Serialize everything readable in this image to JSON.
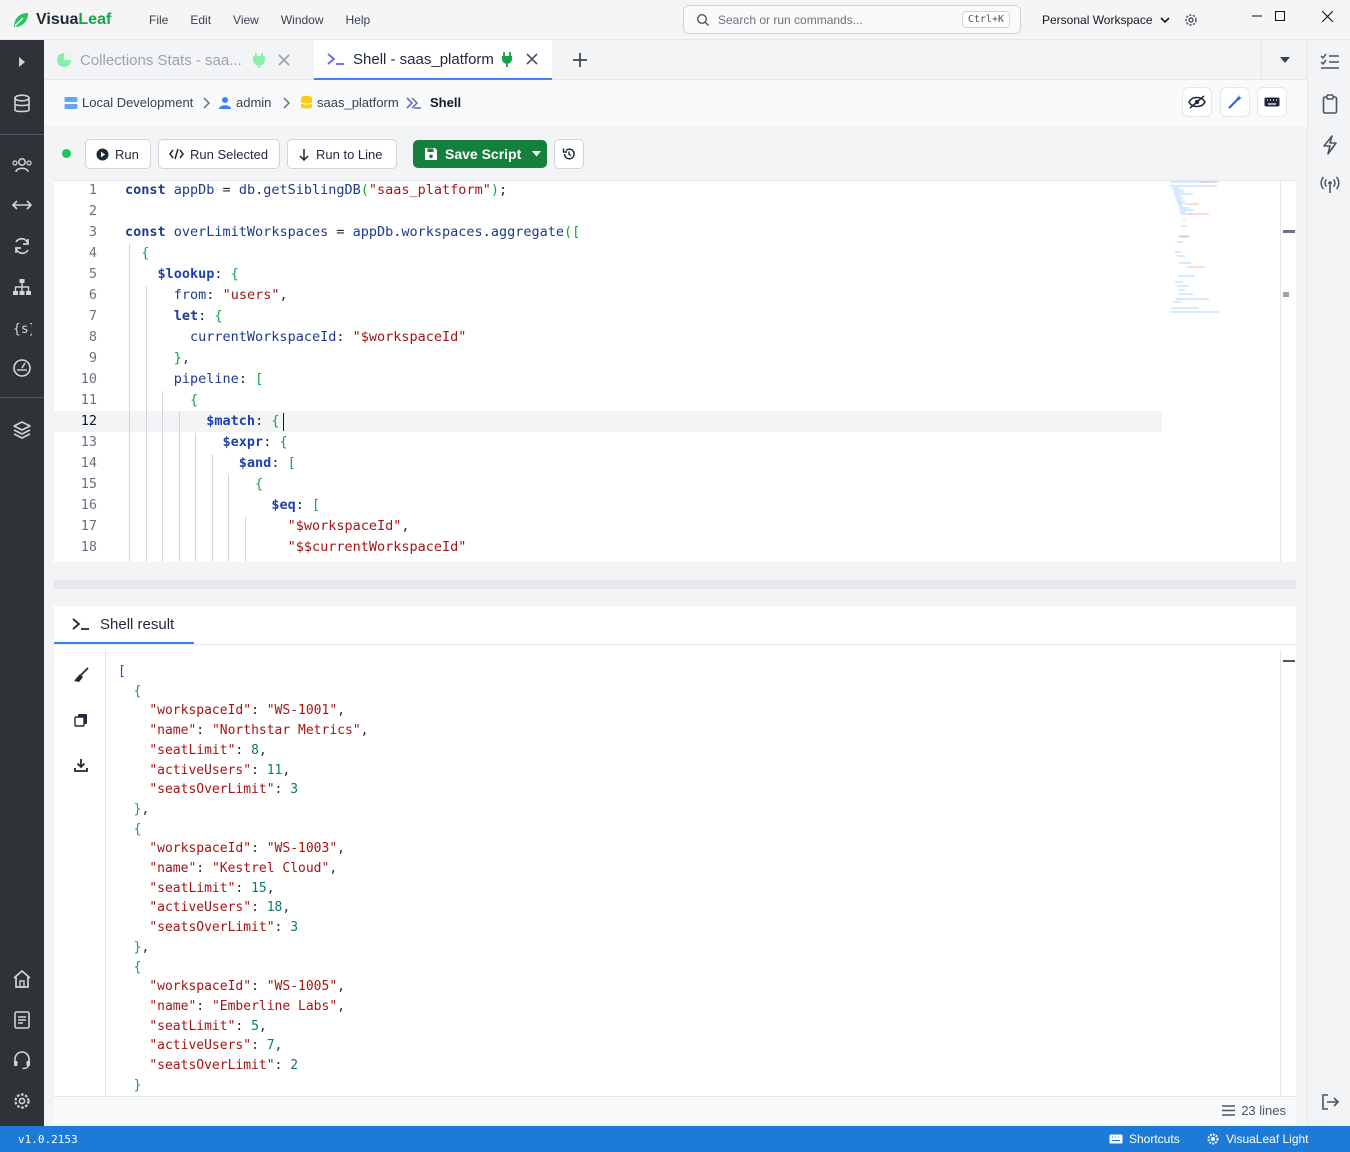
{
  "app": {
    "name_part1": "Visua",
    "name_part2": "Leaf"
  },
  "menu": [
    "File",
    "Edit",
    "View",
    "Window",
    "Help"
  ],
  "search": {
    "placeholder": "Search or run commands...",
    "shortcut": "Ctrl+K"
  },
  "workspace": {
    "label": "Personal Workspace"
  },
  "tabs": [
    {
      "label": "Collections Stats - saa...",
      "active": false
    },
    {
      "label": "Shell - saas_platform",
      "active": true
    }
  ],
  "breadcrumb": {
    "connection": "Local Development",
    "user": "admin",
    "database": "saas_platform",
    "view": "Shell"
  },
  "toolbar": {
    "run": "Run",
    "run_selected": "Run Selected",
    "run_to_line": "Run to Line",
    "save_script": "Save Script"
  },
  "editor": {
    "current_line": 12,
    "lines": [
      "const appDb = db.getSiblingDB(\"saas_platform\");",
      "",
      "const overLimitWorkspaces = appDb.workspaces.aggregate([",
      "  {",
      "    $lookup: {",
      "      from: \"users\",",
      "      let: {",
      "        currentWorkspaceId: \"$workspaceId\"",
      "      },",
      "      pipeline: [",
      "        {",
      "          $match: {",
      "            $expr: {",
      "              $and: [",
      "                {",
      "                  $eq: [",
      "                    \"$workspaceId\",",
      "                    \"$$currentWorkspaceId\""
    ]
  },
  "result": {
    "tab_label": "Shell result",
    "line_count": "23 lines",
    "docs": [
      {
        "workspaceId": "WS-1001",
        "name": "Northstar Metrics",
        "seatLimit": 8,
        "activeUsers": 11,
        "seatsOverLimit": 3
      },
      {
        "workspaceId": "WS-1003",
        "name": "Kestrel Cloud",
        "seatLimit": 15,
        "activeUsers": 18,
        "seatsOverLimit": 3
      },
      {
        "workspaceId": "WS-1005",
        "name": "Emberline Labs",
        "seatLimit": 5,
        "activeUsers": 7,
        "seatsOverLimit": 2
      }
    ]
  },
  "statusbar": {
    "version": "v1.0.2153",
    "shortcuts": "Shortcuts",
    "theme": "VisuaLeaf Light"
  },
  "colors": {
    "accent": "#3b82f6",
    "brand_green": "#16a34a",
    "save_button": "#15803d",
    "statusbar": "#1d7ad6",
    "sidebar": "#2f3337"
  }
}
